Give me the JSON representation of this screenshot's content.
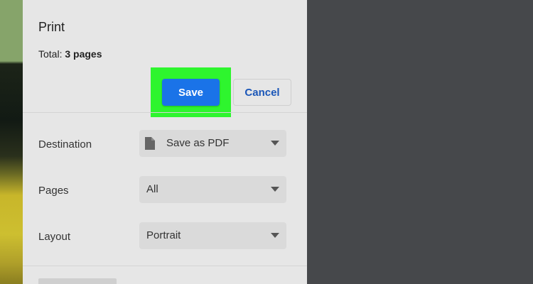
{
  "dialog": {
    "title": "Print",
    "total_label": "Total: ",
    "total_pages": "3 pages"
  },
  "actions": {
    "save_label": "Save",
    "cancel_label": "Cancel"
  },
  "settings": {
    "destination": {
      "label": "Destination",
      "value": "Save as PDF",
      "icon": "document-icon"
    },
    "pages": {
      "label": "Pages",
      "value": "All"
    },
    "layout": {
      "label": "Layout",
      "value": "Portrait"
    }
  },
  "colors": {
    "primary_button": "#1a73e8",
    "highlight": "#2ef52e",
    "panel_bg": "#e6e6e6",
    "preview_bg": "#46484b"
  }
}
